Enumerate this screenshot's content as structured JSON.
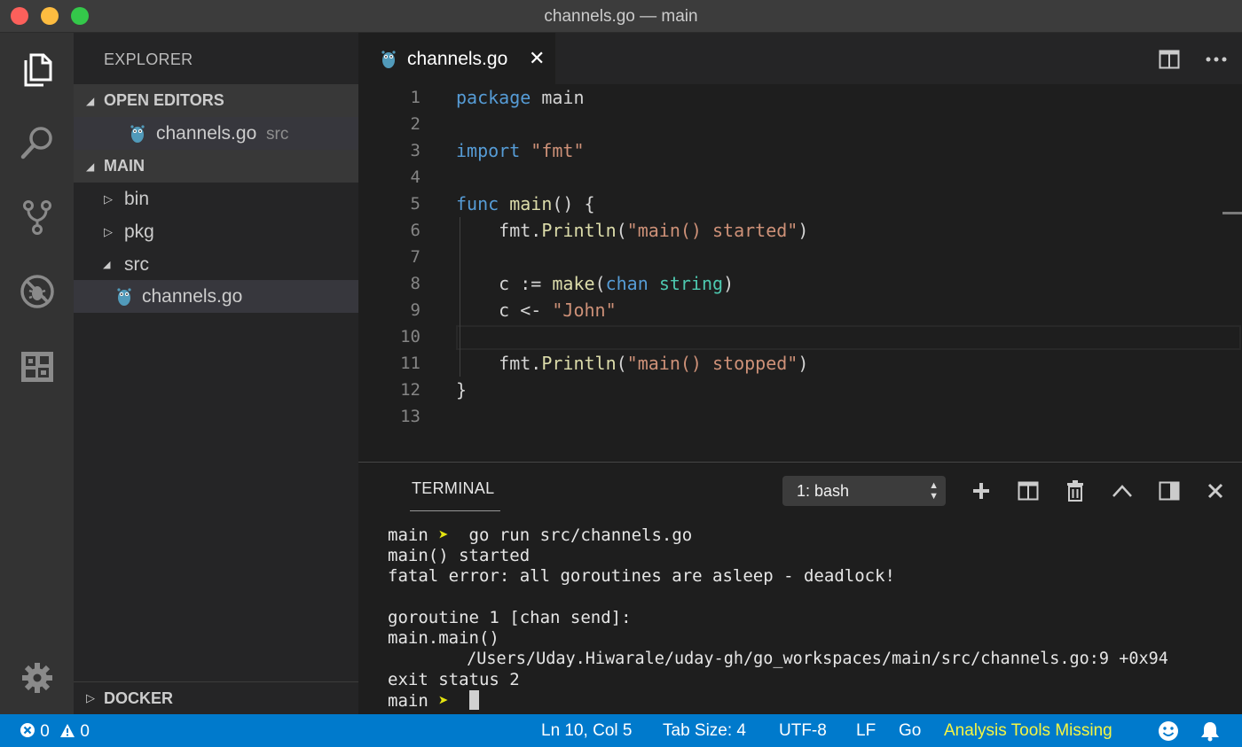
{
  "window": {
    "title": "channels.go — main"
  },
  "sidebar": {
    "title": "EXPLORER",
    "open_editors": {
      "label": "OPEN EDITORS",
      "items": [
        {
          "name": "channels.go",
          "description": "src"
        }
      ]
    },
    "main": {
      "label": "MAIN",
      "items": [
        {
          "name": "bin"
        },
        {
          "name": "pkg"
        },
        {
          "name": "src"
        },
        {
          "name": "channels.go"
        }
      ]
    },
    "docker": {
      "label": "DOCKER"
    }
  },
  "editor": {
    "tab": {
      "label": "channels.go",
      "close": "✕"
    },
    "line_numbers": [
      "1",
      "2",
      "3",
      "4",
      "5",
      "6",
      "7",
      "8",
      "9",
      "10",
      "11",
      "12",
      "13"
    ],
    "current_line": 10
  },
  "panel": {
    "tab_label": "TERMINAL",
    "terminal_select": "1: bash",
    "terminal_lines": [
      {
        "prompt": "main",
        "arrow": "➤",
        "text": "  go run src/channels.go"
      },
      {
        "text": "main() started"
      },
      {
        "text": "fatal error: all goroutines are asleep - deadlock!"
      },
      {
        "text": ""
      },
      {
        "text": "goroutine 1 [chan send]:"
      },
      {
        "text": "main.main()"
      },
      {
        "text": "        /Users/Uday.Hiwarale/uday-gh/go_workspaces/main/src/channels.go:9 +0x94"
      },
      {
        "text": "exit status 2"
      },
      {
        "prompt": "main",
        "arrow": "➤",
        "text": "  "
      }
    ]
  },
  "statusbar": {
    "errors": "0",
    "warnings": "0",
    "position": "Ln 10, Col 5",
    "tab_size": "Tab Size: 4",
    "encoding": "UTF-8",
    "eol": "LF",
    "language": "Go",
    "tools_warning": "Analysis Tools Missing",
    "warning_color": "#f5f542"
  },
  "colors": {
    "accent": "#007acc",
    "keyword": "#569cd6",
    "string": "#ce9178",
    "function": "#dcdcaa",
    "type": "#4ec9b0"
  }
}
